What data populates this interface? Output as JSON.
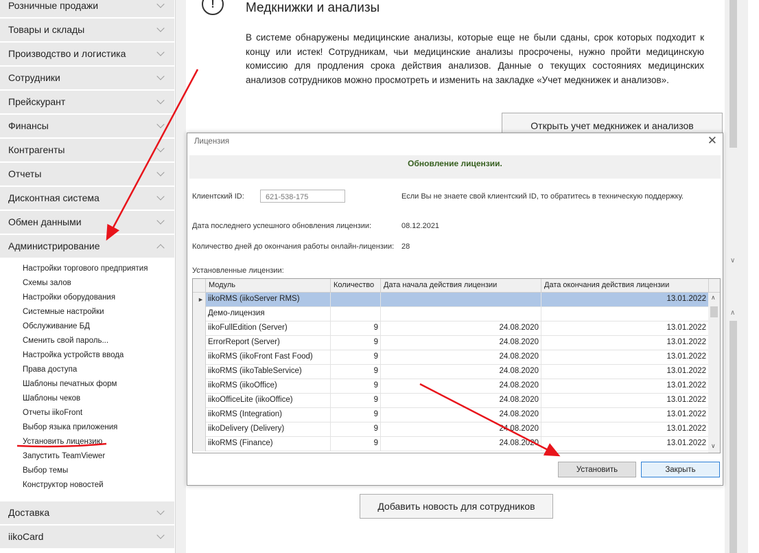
{
  "sidebar": {
    "sections_top": [
      {
        "label": "Розничные продажи"
      },
      {
        "label": "Товары и склады"
      },
      {
        "label": "Производство и логистика"
      },
      {
        "label": "Сотрудники"
      },
      {
        "label": "Прейскурант"
      },
      {
        "label": "Финансы"
      },
      {
        "label": "Контрагенты"
      },
      {
        "label": "Отчеты"
      },
      {
        "label": "Дисконтная система"
      },
      {
        "label": "Обмен данными"
      },
      {
        "label": "Администрирование"
      }
    ],
    "admin_items": [
      "Настройки торгового предприятия",
      "Схемы залов",
      "Настройки оборудования",
      "Системные настройки",
      "Обслуживание БД",
      "Сменить свой пароль...",
      "Настройка устройств ввода",
      "Права доступа",
      "Шаблоны печатных форм",
      "Шаблоны чеков",
      "Отчеты iikoFront",
      "Выбор языка приложения",
      "Установить лицензию",
      "Запустить TeamViewer",
      "Выбор темы",
      "Конструктор новостей"
    ],
    "sections_bottom": [
      {
        "label": "Доставка"
      },
      {
        "label": "iikoCard"
      }
    ]
  },
  "main": {
    "med_title": "Медкнижки и анализы",
    "med_text": "В системе обнаружены медицинские анализы, которые еще не были сданы, срок которых подходит к концу или истек! Сотрудникам, чьи медицинские анализы просрочены, нужно пройти медицинскую комиссию для продления срока действия анализов. Данные о текущих состояниях медицинских анализов сотрудников можно просмотреть и изменить на закладке «Учет медкнижек и анализов».",
    "open_med_button": "Открыть учет медкнижек и анализов",
    "add_news_button": "Добавить новость для сотрудников"
  },
  "dialog": {
    "title": "Лицензия",
    "close_glyph": "✕",
    "header": "Обновление лицензии.",
    "client_id_label": "Клиентский ID:",
    "client_id_value": "621-538-175",
    "client_id_hint": "Если Вы не знаете свой клиентский ID, то обратитесь в техническую поддержку.",
    "last_update_label": "Дата последнего успешного обновления лицензии:",
    "last_update_value": "08.12.2021",
    "days_left_label": "Количество дней до окончания работы онлайн-лицензии:",
    "days_left_value": "28",
    "installed_label": "Установленные лицензии:",
    "columns": [
      "Модуль",
      "Количество",
      "Дата начала действия лицензии",
      "Дата окончания действия лицензии"
    ],
    "rows": [
      {
        "module": "iikoRMS (iikoServer RMS)",
        "qty": "",
        "start": "",
        "end": "13.01.2022"
      },
      {
        "module": "Демо-лицензия",
        "qty": "",
        "start": "",
        "end": ""
      },
      {
        "module": "iikoFullEdition (Server)",
        "qty": "9",
        "start": "24.08.2020",
        "end": "13.01.2022"
      },
      {
        "module": "ErrorReport (Server)",
        "qty": "9",
        "start": "24.08.2020",
        "end": "13.01.2022"
      },
      {
        "module": "iikoRMS (iikoFront Fast Food)",
        "qty": "9",
        "start": "24.08.2020",
        "end": "13.01.2022"
      },
      {
        "module": "iikoRMS (iikoTableService)",
        "qty": "9",
        "start": "24.08.2020",
        "end": "13.01.2022"
      },
      {
        "module": "iikoRMS (iikoOffice)",
        "qty": "9",
        "start": "24.08.2020",
        "end": "13.01.2022"
      },
      {
        "module": "iikoOfficeLite (iikoOffice)",
        "qty": "9",
        "start": "24.08.2020",
        "end": "13.01.2022"
      },
      {
        "module": "iikoRMS (Integration)",
        "qty": "9",
        "start": "24.08.2020",
        "end": "13.01.2022"
      },
      {
        "module": "iikoDelivery (Delivery)",
        "qty": "9",
        "start": "24.08.2020",
        "end": "13.01.2022"
      },
      {
        "module": "iikoRMS (Finance)",
        "qty": "9",
        "start": "24.08.2020",
        "end": "13.01.2022"
      }
    ],
    "current_row_marker": "►",
    "install_button": "Установить",
    "close_button": "Закрыть"
  },
  "colors": {
    "selected_row": "#aec6e6",
    "annotation": "#e8141b",
    "header_text": "#365f1f"
  }
}
